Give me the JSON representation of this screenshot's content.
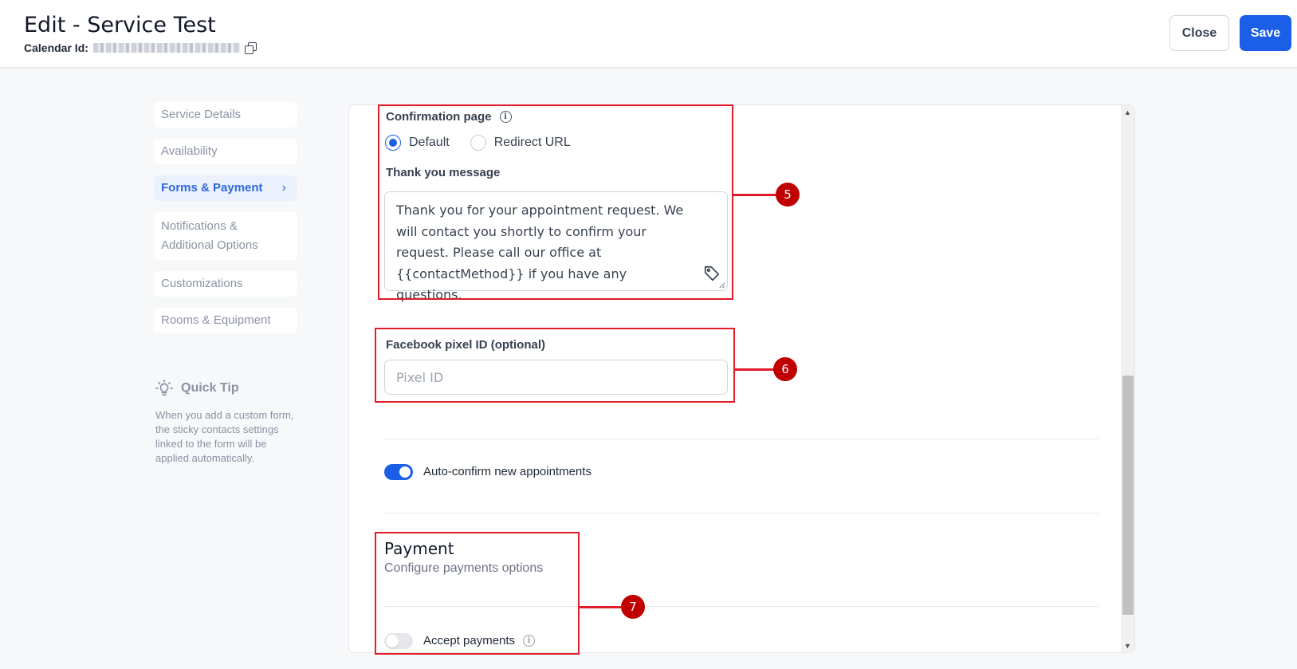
{
  "header": {
    "title": "Edit - Service Test",
    "calendar_id_label": "Calendar Id:",
    "close_label": "Close",
    "save_label": "Save"
  },
  "sidebar": {
    "items": [
      {
        "label": "Service Details",
        "active": false
      },
      {
        "label": "Availability",
        "active": false
      },
      {
        "label": "Forms & Payment",
        "active": true
      },
      {
        "label": "Notifications & Additional Options",
        "active": false
      },
      {
        "label": "Customizations",
        "active": false
      },
      {
        "label": "Rooms & Equipment",
        "active": false
      }
    ],
    "quick_tip": {
      "title": "Quick Tip",
      "text": "When you add a custom form, the sticky contacts settings linked to the form will be applied automatically."
    }
  },
  "form": {
    "confirmation_page": {
      "label": "Confirmation page",
      "options": [
        "Default",
        "Redirect URL"
      ],
      "selected": "Default"
    },
    "thank_you": {
      "label": "Thank you message",
      "value": "Thank you for your appointment request. We will contact you shortly to confirm your request. Please call our office at {{contactMethod}} if you have any questions."
    },
    "facebook_pixel": {
      "label": "Facebook pixel ID (optional)",
      "placeholder": "Pixel ID",
      "value": ""
    },
    "auto_confirm": {
      "label": "Auto-confirm new appointments",
      "enabled": true
    },
    "payment": {
      "title": "Payment",
      "subtitle": "Configure payments options",
      "accept_payments_label": "Accept payments",
      "accept_payments_enabled": false
    }
  },
  "annotations": [
    "5",
    "6",
    "7"
  ],
  "colors": {
    "primary": "#1a5fe6",
    "annotation": "#e11d2a",
    "badge": "#c00000"
  }
}
